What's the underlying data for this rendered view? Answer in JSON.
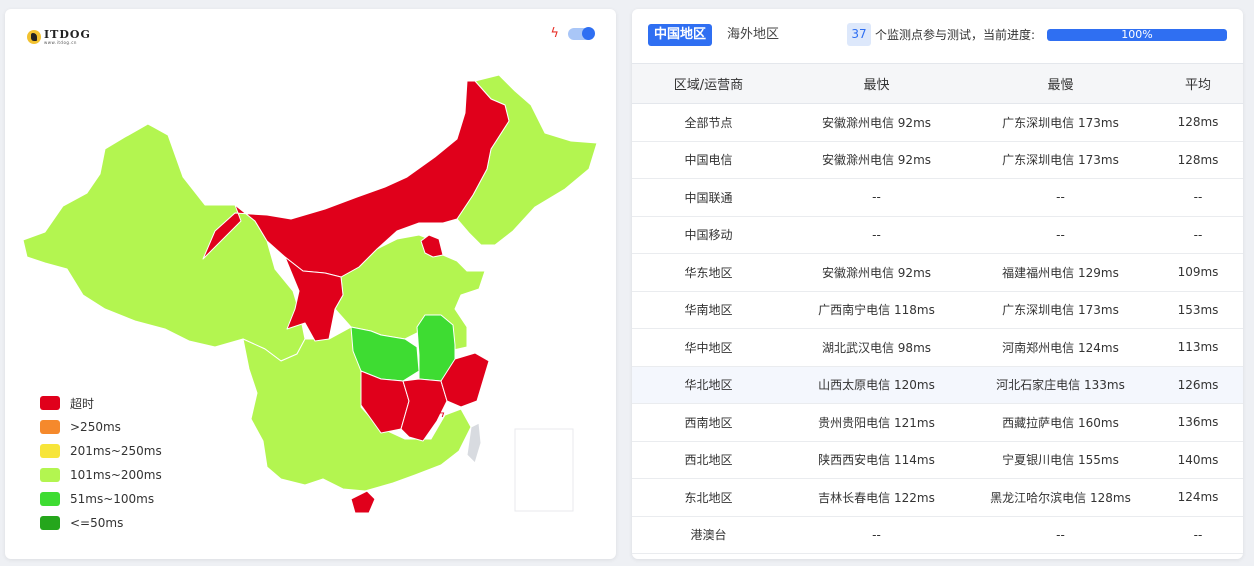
{
  "map_panel": {
    "logo_text": "ITDOG",
    "logo_subtext": "www.itdog.cn",
    "bolt_icon": "lightning-icon",
    "toggle_on": true,
    "legend": [
      {
        "label": "超时",
        "color": "#e0001b"
      },
      {
        "label": ">250ms",
        "color": "#f5892c"
      },
      {
        "label": "201ms~250ms",
        "color": "#f7e53a"
      },
      {
        "label": "101ms~200ms",
        "color": "#b3f550"
      },
      {
        "label": "51ms~100ms",
        "color": "#3edc32"
      },
      {
        "label": "<=50ms",
        "color": "#25a61c"
      }
    ]
  },
  "tabs": {
    "domestic": "中国地区",
    "overseas": "海外地区"
  },
  "status": {
    "node_count": "37",
    "node_text": "个监测点参与测试，当前进度:",
    "progress_label": "100%",
    "progress": 1.0
  },
  "table": {
    "headers": [
      "区域/运营商",
      "最快",
      "最慢",
      "平均"
    ],
    "rows": [
      [
        "全部节点",
        "安徽滁州电信 92ms",
        "广东深圳电信 173ms",
        "128ms"
      ],
      [
        "中国电信",
        "安徽滁州电信 92ms",
        "广东深圳电信 173ms",
        "128ms"
      ],
      [
        "中国联通",
        "--",
        "--",
        "--"
      ],
      [
        "中国移动",
        "--",
        "--",
        "--"
      ],
      [
        "华东地区",
        "安徽滁州电信 92ms",
        "福建福州电信 129ms",
        "109ms"
      ],
      [
        "华南地区",
        "广西南宁电信 118ms",
        "广东深圳电信 173ms",
        "153ms"
      ],
      [
        "华中地区",
        "湖北武汉电信 98ms",
        "河南郑州电信 124ms",
        "113ms"
      ],
      [
        "华北地区",
        "山西太原电信 120ms",
        "河北石家庄电信 133ms",
        "126ms"
      ],
      [
        "西南地区",
        "贵州贵阳电信 121ms",
        "西藏拉萨电信 160ms",
        "136ms"
      ],
      [
        "西北地区",
        "陕西西安电信 114ms",
        "宁夏银川电信 155ms",
        "140ms"
      ],
      [
        "东北地区",
        "吉林长春电信 122ms",
        "黑龙江哈尔滨电信 128ms",
        "124ms"
      ],
      [
        "港澳台",
        "--",
        "--",
        "--"
      ]
    ],
    "highlight_row": 7
  }
}
